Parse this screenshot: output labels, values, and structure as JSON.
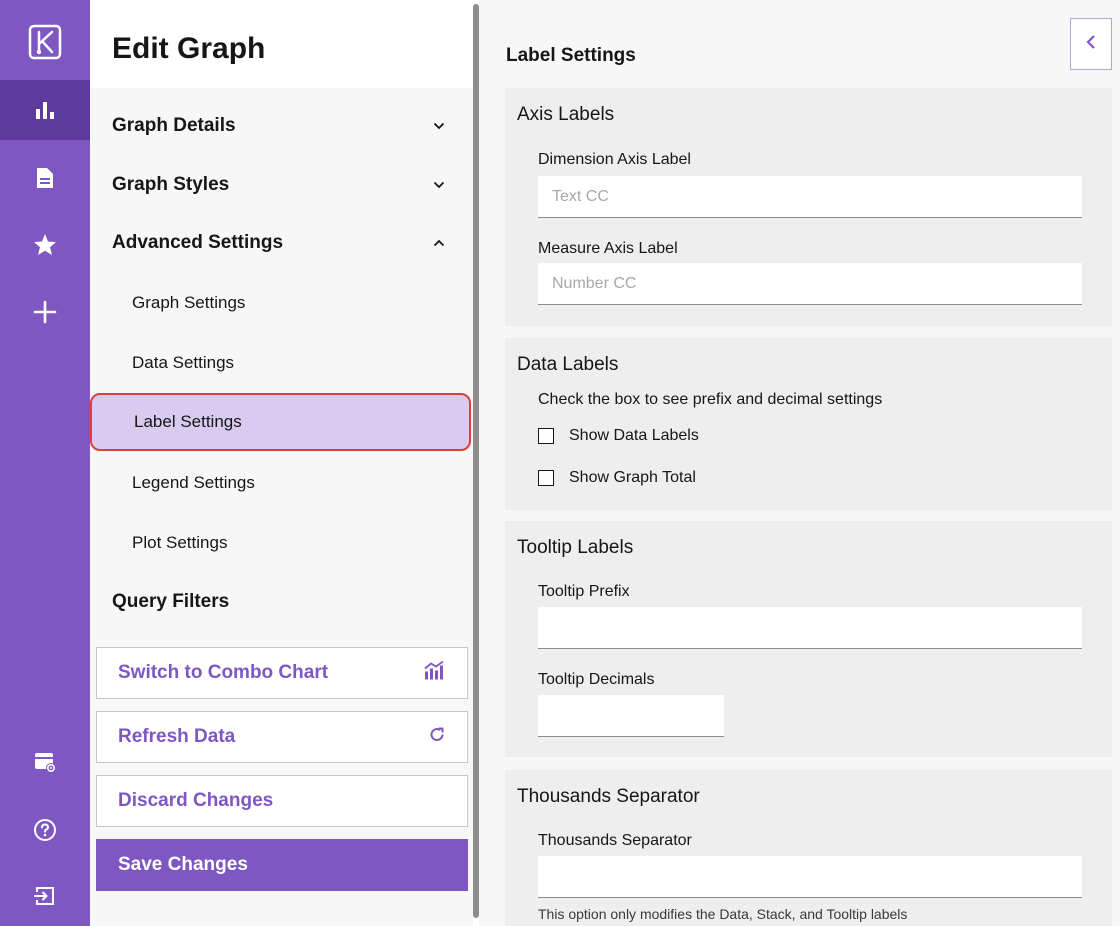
{
  "rail": {
    "items": [
      {
        "name": "logo-icon"
      },
      {
        "name": "bar-chart-icon",
        "active": true
      },
      {
        "name": "document-icon"
      },
      {
        "name": "star-icon"
      },
      {
        "name": "plus-icon"
      },
      {
        "name": "settings-panel-icon"
      },
      {
        "name": "help-icon"
      },
      {
        "name": "logout-icon"
      }
    ],
    "accent": "#7e57c2",
    "active_bg": "#5e3a9e"
  },
  "menu": {
    "title": "Edit Graph",
    "sections": {
      "graph_details": "Graph Details",
      "graph_styles": "Graph Styles",
      "advanced_settings": "Advanced Settings",
      "query_filters": "Query Filters"
    },
    "advanced_items": {
      "graph_settings": "Graph Settings",
      "data_settings": "Data Settings",
      "label_settings": "Label Settings",
      "legend_settings": "Legend Settings",
      "plot_settings": "Plot Settings"
    },
    "selected": "Label Settings",
    "buttons": {
      "switch_combo": "Switch to Combo Chart",
      "refresh": "Refresh Data",
      "discard": "Discard Changes",
      "save": "Save Changes"
    }
  },
  "panel": {
    "title": "Label Settings",
    "axis_labels": {
      "title": "Axis Labels",
      "dimension_label": "Dimension Axis Label",
      "dimension_placeholder": "Text CC",
      "measure_label": "Measure Axis Label",
      "measure_placeholder": "Number CC"
    },
    "data_labels": {
      "title": "Data Labels",
      "hint": "Check the box to see prefix and decimal settings",
      "show_data_labels": "Show Data Labels",
      "show_graph_total": "Show Graph Total"
    },
    "tooltip_labels": {
      "title": "Tooltip Labels",
      "prefix_label": "Tooltip Prefix",
      "decimals_label": "Tooltip Decimals"
    },
    "thousands": {
      "title": "Thousands Separator",
      "field_label": "Thousands Separator",
      "note": "This option only modifies the Data, Stack, and Tooltip labels"
    }
  }
}
